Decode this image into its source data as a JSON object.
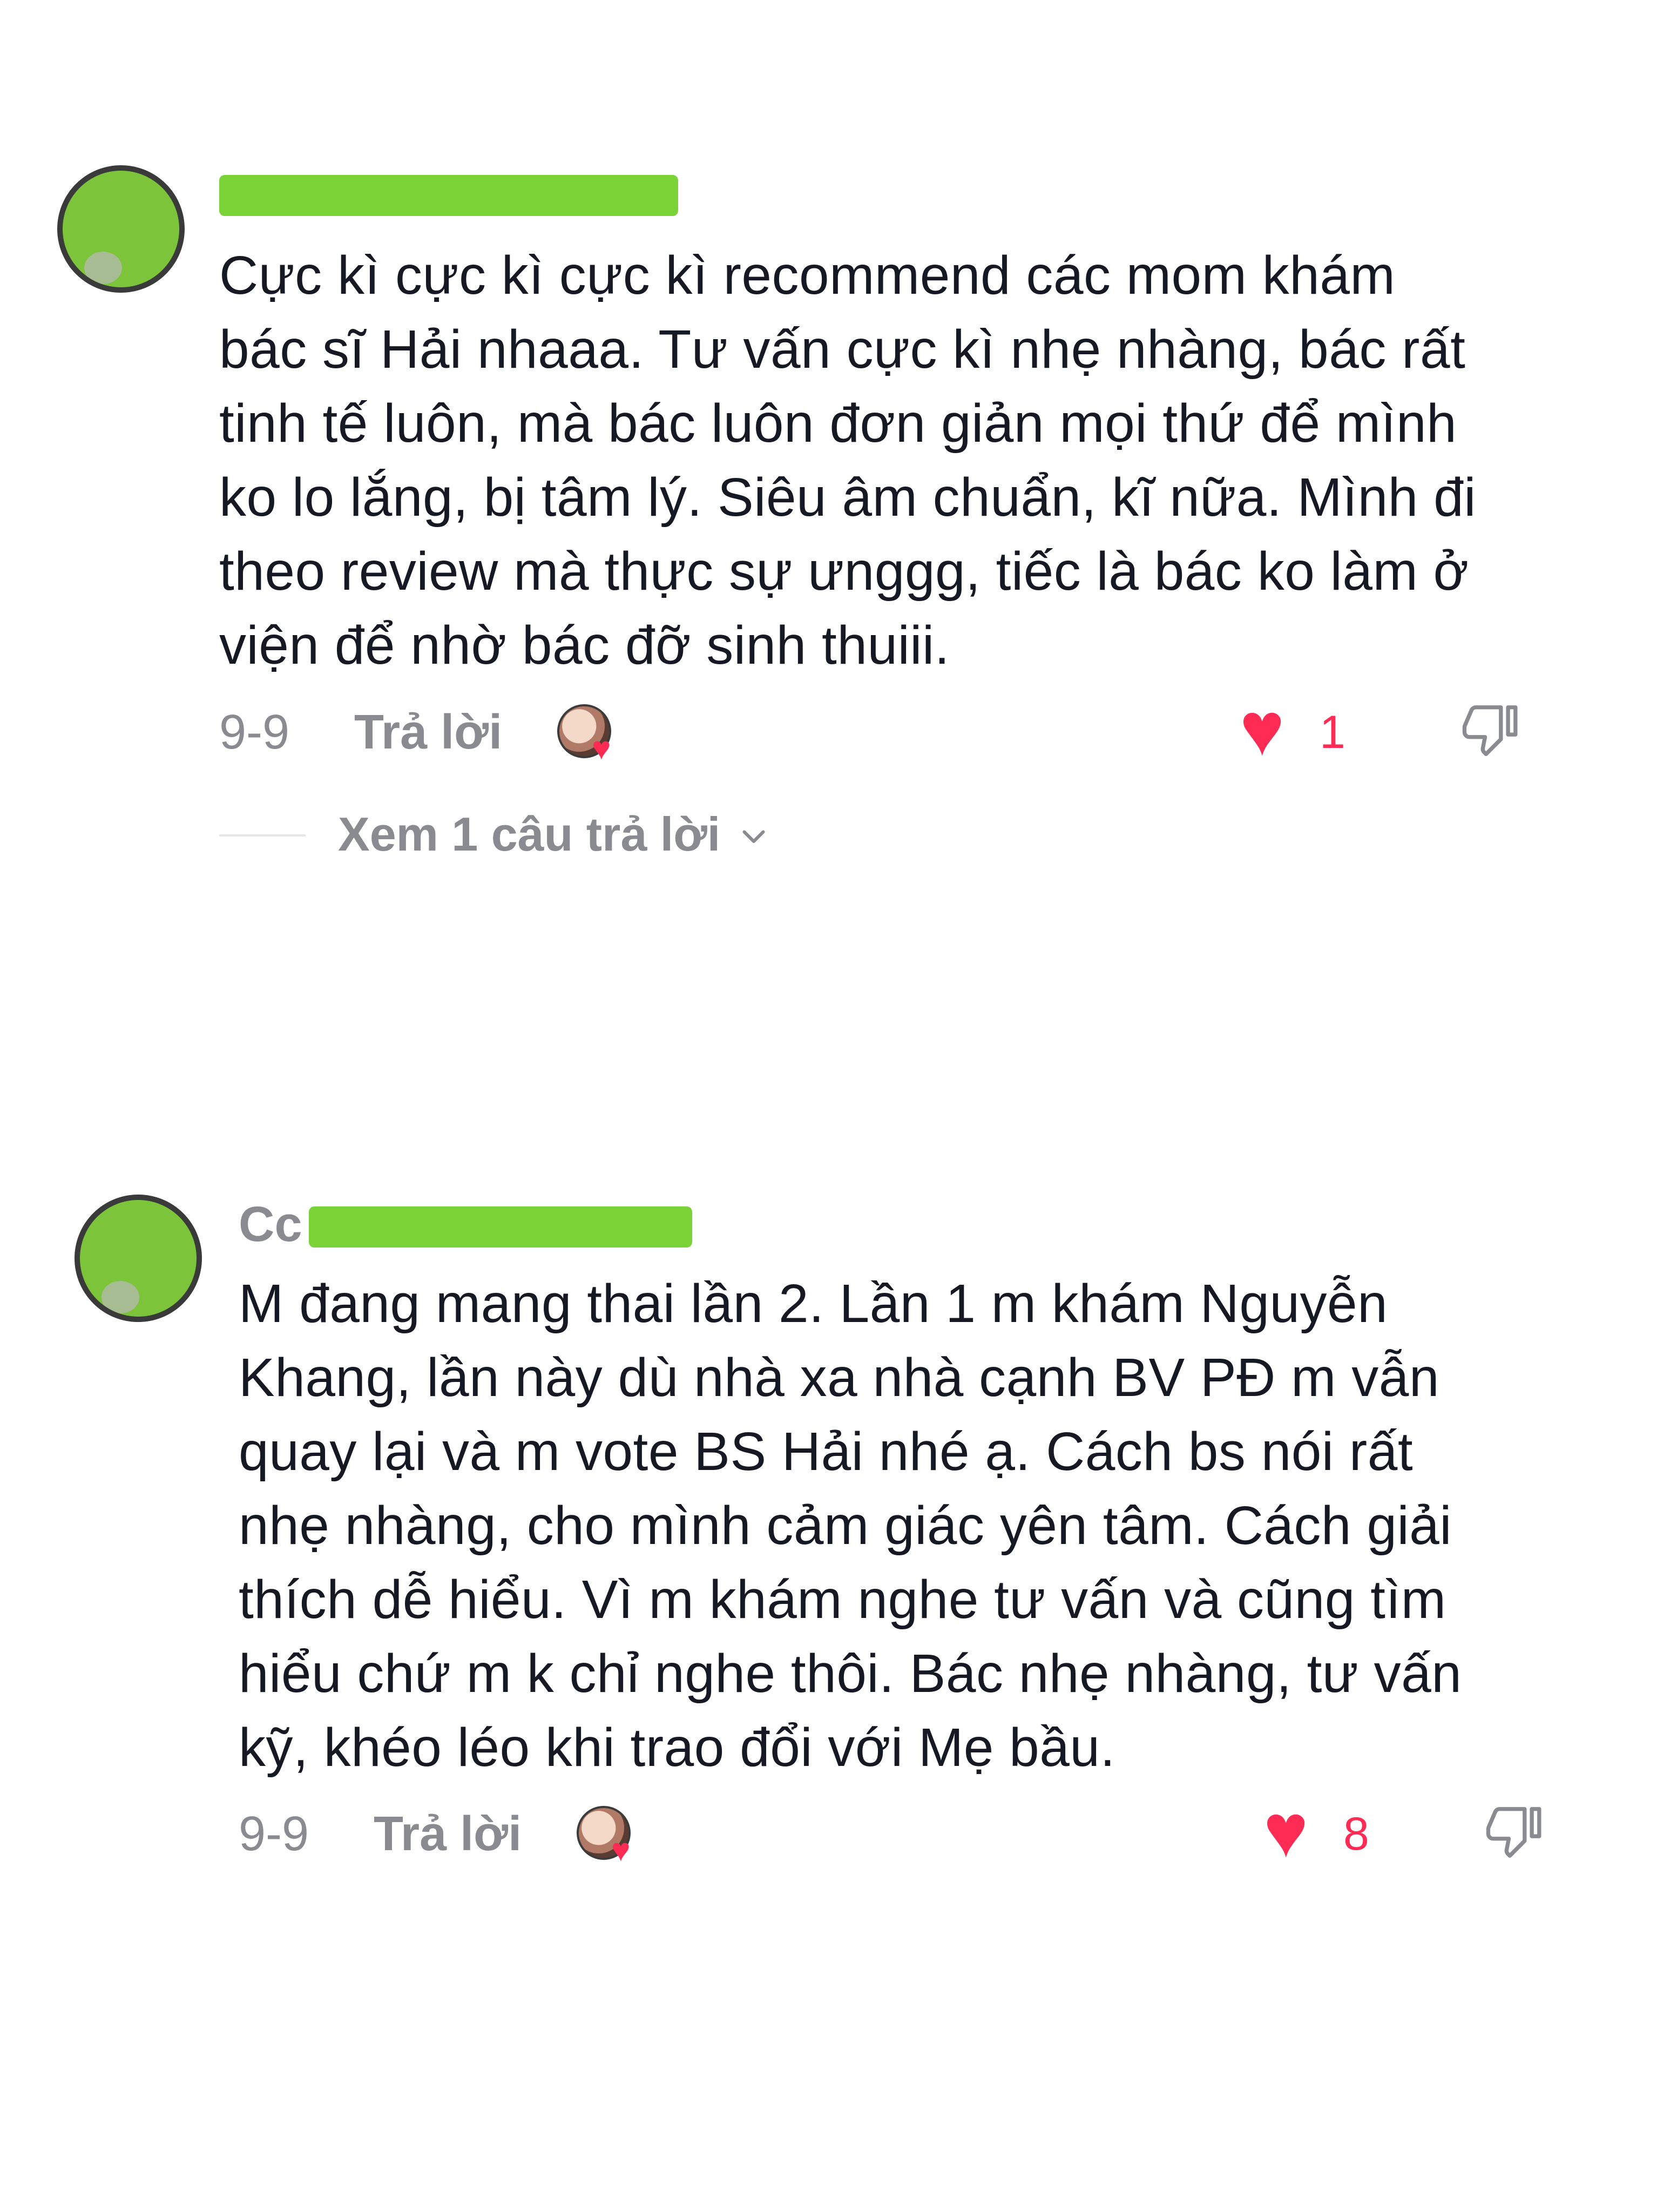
{
  "comments": [
    {
      "author_visible": "",
      "author_redacted": true,
      "text": "Cực kì cực kì cực kì recommend các mom khám\nbác sĩ Hải nhaaa. Tư vấn cực kì nhẹ nhàng, bác rất\ntinh tế luôn, mà bác luôn đơn giản mọi thứ để mình\nko lo lắng, bị tâm lý. Siêu âm chuẩn, kĩ nữa. Mình đi\ntheo review mà thực sự ưnggg, tiếc là bác ko làm ở\nviện để nhờ bác đỡ sinh thuiii.",
      "date": "9-9",
      "reply_label": "Trả lời",
      "likes": "1",
      "creator_liked": true,
      "view_replies_label": "Xem 1 câu trả lời"
    },
    {
      "author_visible": "Cc",
      "author_redacted": true,
      "text": "M đang mang thai lần 2. Lần 1 m khám Nguyễn\nKhang, lần này dù nhà xa nhà cạnh BV PĐ m vẫn\nquay lại và m vote BS Hải nhé ạ. Cách bs nói rất\nnhẹ nhàng, cho mình cảm giác yên tâm. Cách giải\nthích dễ hiểu. Vì m khám nghe tư vấn và cũng tìm\nhiểu chứ m k chỉ nghe thôi. Bác nhẹ nhàng, tư vấn\nkỹ, khéo léo khi trao đổi với Mẹ bầu.",
      "date": "9-9",
      "reply_label": "Trả lời",
      "likes": "8",
      "creator_liked": true
    }
  ],
  "colors": {
    "like": "#fe2c55",
    "muted": "#8a8b91",
    "redaction": "#79d236"
  },
  "icons": {
    "like": "heart-icon",
    "dislike": "thumbs-down-icon",
    "expand": "chevron-down-icon"
  }
}
